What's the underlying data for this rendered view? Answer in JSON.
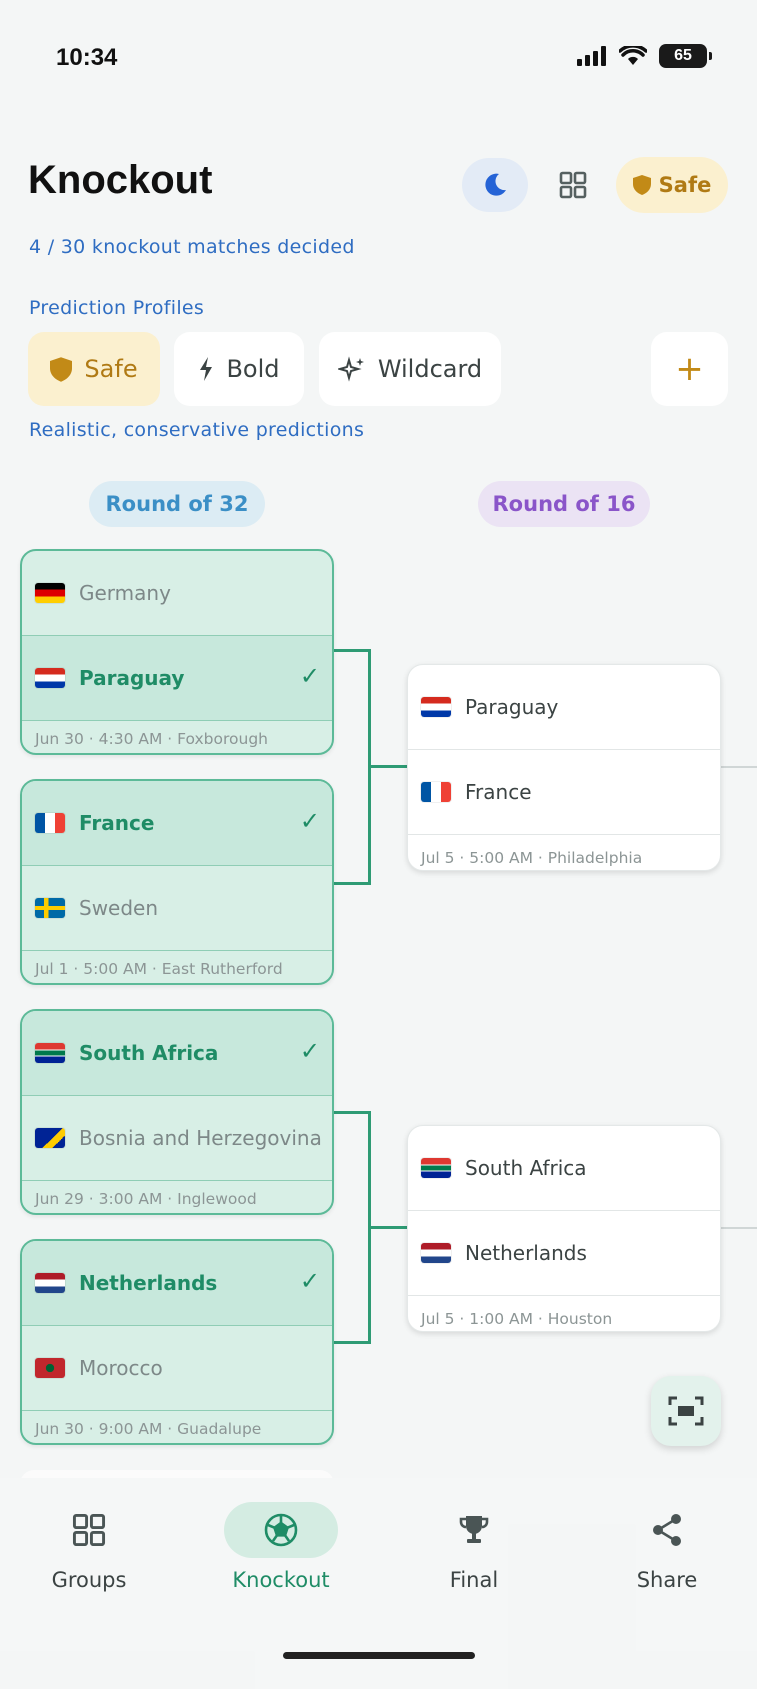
{
  "status": {
    "time": "10:34",
    "battery": "65"
  },
  "header": {
    "title": "Knockout",
    "safe_label": "Safe",
    "decided": "4 / 30 knockout matches decided"
  },
  "profiles": {
    "label": "Prediction Profiles",
    "items": [
      {
        "label": "Safe",
        "icon": "shield-icon"
      },
      {
        "label": "Bold",
        "icon": "bolt-icon"
      },
      {
        "label": "Wildcard",
        "icon": "sparkle-icon"
      }
    ],
    "add": "+",
    "description": "Realistic, conservative predictions"
  },
  "rounds": [
    "Round of 32",
    "Round of 16"
  ],
  "r32": [
    {
      "teams": [
        {
          "name": "Germany",
          "flag": "de"
        },
        {
          "name": "Paraguay",
          "flag": "py",
          "winner": true
        }
      ],
      "meta": "Jun 30 · 4:30 AM · Foxborough"
    },
    {
      "teams": [
        {
          "name": "France",
          "flag": "fr",
          "winner": true
        },
        {
          "name": "Sweden",
          "flag": "se"
        }
      ],
      "meta": "Jul 1 · 5:00 AM · East Rutherford"
    },
    {
      "teams": [
        {
          "name": "South Africa",
          "flag": "za",
          "winner": true
        },
        {
          "name": "Bosnia and Herzegovina",
          "flag": "ba"
        }
      ],
      "meta": "Jun 29 · 3:00 AM · Inglewood"
    },
    {
      "teams": [
        {
          "name": "Netherlands",
          "flag": "nl",
          "winner": true
        },
        {
          "name": "Morocco",
          "flag": "ma"
        }
      ],
      "meta": "Jun 30 · 9:00 AM · Guadalupe"
    }
  ],
  "r16": [
    {
      "teams": [
        {
          "name": "Paraguay",
          "flag": "py"
        },
        {
          "name": "France",
          "flag": "fr"
        }
      ],
      "meta": "Jul 5 · 5:00 AM · Philadelphia"
    },
    {
      "teams": [
        {
          "name": "South Africa",
          "flag": "za"
        },
        {
          "name": "Netherlands",
          "flag": "nl"
        }
      ],
      "meta": "Jul 5 · 1:00 AM · Houston"
    }
  ],
  "check": "✓",
  "nav": [
    {
      "label": "Groups",
      "icon": "grid-icon"
    },
    {
      "label": "Knockout",
      "icon": "soccer-ball-icon",
      "active": true
    },
    {
      "label": "Final",
      "icon": "trophy-icon"
    },
    {
      "label": "Share",
      "icon": "share-icon"
    }
  ],
  "colors": {
    "accent": "#1f8c66",
    "safe": "#b07a14",
    "link": "#2f6dc2"
  }
}
